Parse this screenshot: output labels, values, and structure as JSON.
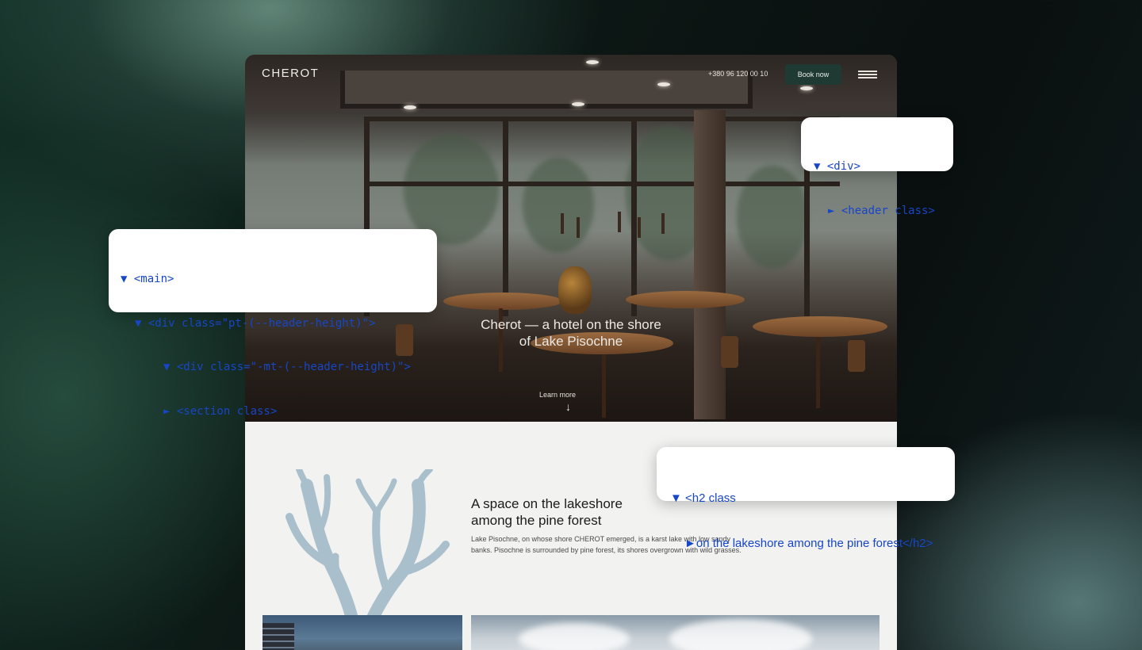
{
  "site": {
    "logo": "CHEROT",
    "phone": "+380 96 120 00 10",
    "book_label": "Book now",
    "hero_title_line1": "Cherot — a hotel on the shore",
    "hero_title_line2": "of Lake Pisochne",
    "learn_more": "Learn more",
    "arrow_glyph": "↓",
    "section_title_line1": "A space on the lakeshore",
    "section_title_line2": "among the pine forest",
    "section_text": "Lake Pisochne, on whose shore CHEROT emerged, is a karst lake with low sandy banks. Pisochne is surrounded by pine forest, its shores overgrown with wild grasses."
  },
  "annotations": {
    "header_card": [
      "▼ <div>",
      "► <header class>"
    ],
    "main_card": [
      "▼ <main>",
      "▼ <div class=\"pt-(--header-height)\">",
      "▼ <div class=\"-mt-(--header-height)\">",
      "► <section class>"
    ],
    "h2_card": [
      "▼ <h2 class",
      "►on the lakeshore among the pine forest</h2>"
    ]
  },
  "colors": {
    "accent_button": "#1f3a32",
    "annotation_text": "#1746c6",
    "coral": "#a9c0cc"
  },
  "icons": {
    "menu": "hamburger-menu-icon",
    "scroll": "arrow-down-icon",
    "decor": "coral-branch-icon"
  }
}
